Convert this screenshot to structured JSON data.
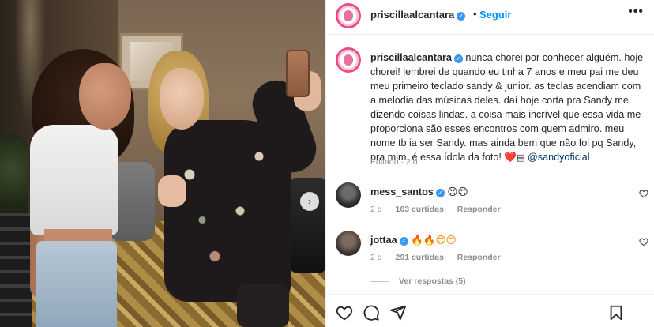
{
  "header": {
    "username": "priscillaalcantara",
    "separator": "•",
    "follow_label": "Seguir",
    "more_label": "•••"
  },
  "caption": {
    "username": "priscillaalcantara",
    "text": "nunca chorei por conhecer alguém. hoje chorei! lembrei de quando eu tinha 7 anos e meu pai me deu meu primeiro teclado sandy & junior. as teclas acendiam com a melodia das músicas deles. daí hoje corta pra Sandy me dizendo coisas lindas. a coisa mais incrível que essa vida me proporciona são esses encontros com quem admiro. meu nome tb ia ser Sandy. mas ainda bem que não foi pq Sandy, pra mim, é essa ídola da foto!",
    "emoji": "❤️",
    "emoji_bars": "▤",
    "mention": "@sandyoficial",
    "edited": "Editado · 2 d"
  },
  "comments": [
    {
      "username": "mess_santos",
      "text": "😍😍",
      "age": "2 d",
      "likes": "163 curtidas",
      "reply": "Responder"
    },
    {
      "username": "jottaa",
      "text": "🔥🔥😍😍",
      "age": "2 d",
      "likes": "291 curtidas",
      "reply": "Responder"
    }
  ],
  "view_replies": "Ver respostas (5)",
  "icons": {
    "verified": "verified-badge-icon",
    "like": "heart-icon",
    "comment": "comment-icon",
    "share": "send-icon",
    "save": "bookmark-icon",
    "next": "chevron-right-icon"
  },
  "colors": {
    "accent": "#0095f6",
    "verified": "#3897f0",
    "mention": "#00376b",
    "muted": "#8e8e8e"
  }
}
